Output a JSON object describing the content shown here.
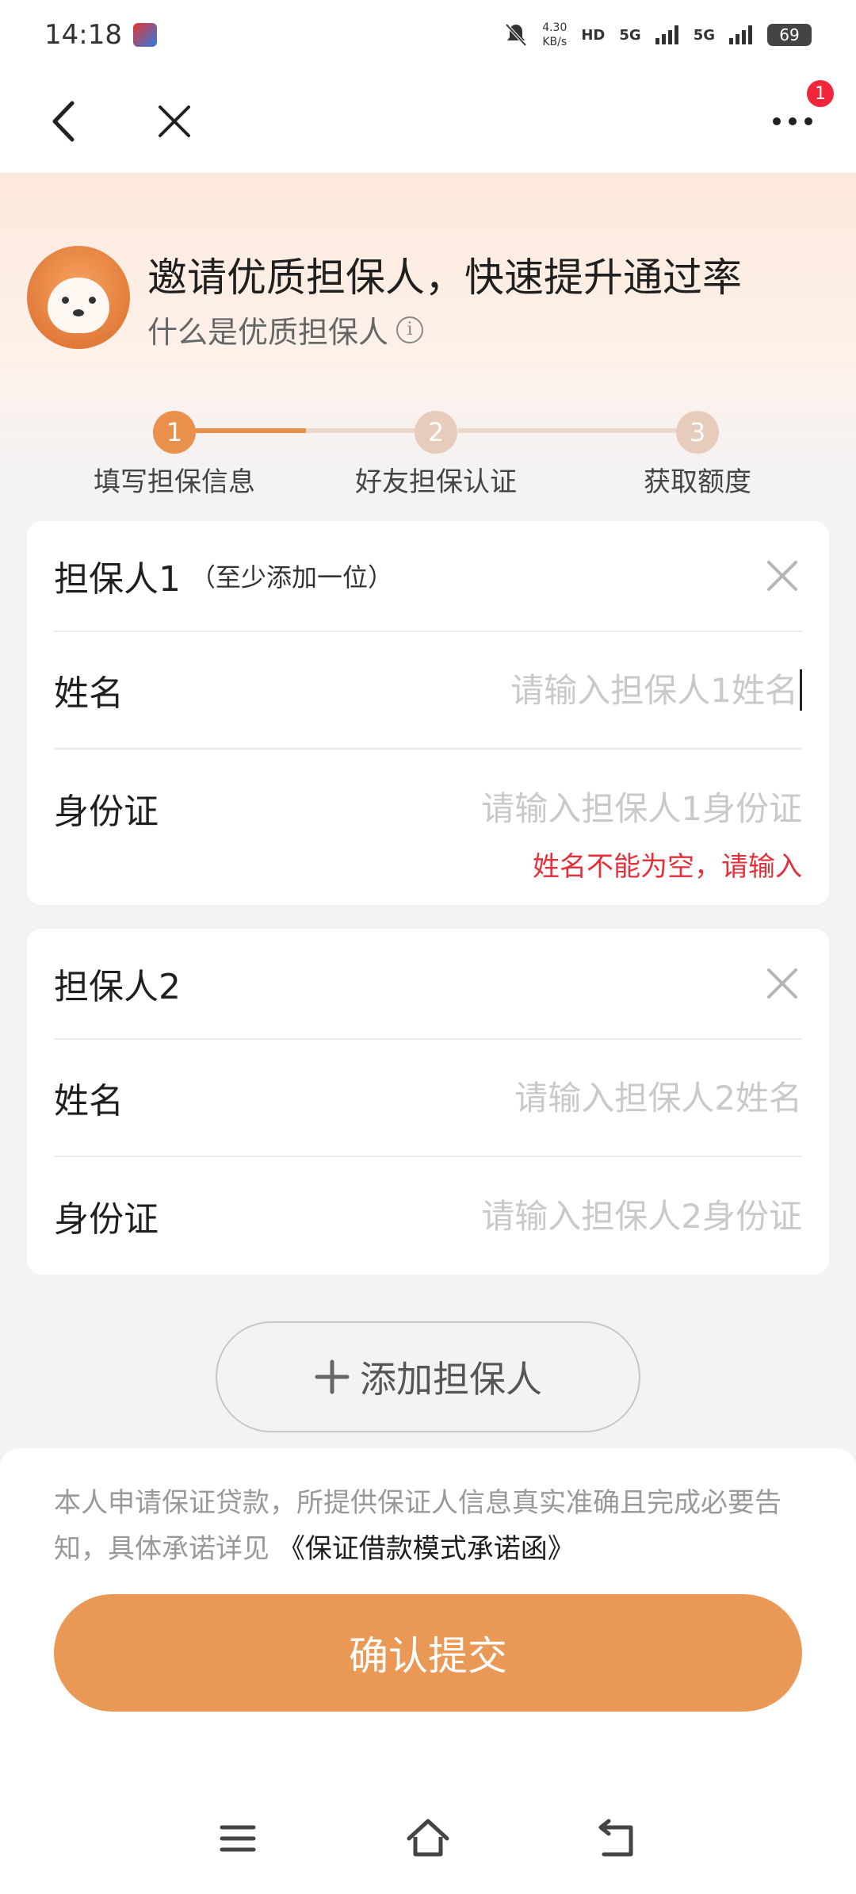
{
  "status_bar": {
    "time": "14:18",
    "net_speed_value": "4.30",
    "net_speed_unit": "KB/s",
    "hd_label": "HD",
    "signal1": "5G",
    "signal2": "5G",
    "battery": "69"
  },
  "nav": {
    "badge_count": "1"
  },
  "header": {
    "title": "邀请优质担保人，快速提升通过率",
    "subtitle": "什么是优质担保人",
    "info_glyph": "i"
  },
  "steps": [
    {
      "number": "1",
      "label": "填写担保信息",
      "active": true
    },
    {
      "number": "2",
      "label": "好友担保认证",
      "active": false
    },
    {
      "number": "3",
      "label": "获取额度",
      "active": false
    }
  ],
  "guarantor1": {
    "title": "担保人1",
    "hint": "（至少添加一位）",
    "name_label": "姓名",
    "name_placeholder": "请输入担保人1姓名",
    "id_label": "身份证",
    "id_placeholder": "请输入担保人1身份证",
    "error": "姓名不能为空，请输入"
  },
  "guarantor2": {
    "title": "担保人2",
    "name_label": "姓名",
    "name_placeholder": "请输入担保人2姓名",
    "id_label": "身份证",
    "id_placeholder": "请输入担保人2身份证"
  },
  "add_button": {
    "icon": "+",
    "label": "添加担保人"
  },
  "agreement": {
    "text": "本人申请保证贷款，所提供保证人信息真实准确且完成必要告知，具体承诺详见 ",
    "link": "《保证借款模式承诺函》"
  },
  "submit": {
    "label": "确认提交"
  },
  "colors": {
    "accent": "#e9914c",
    "submit": "#ea9855",
    "error": "#e3303a"
  }
}
